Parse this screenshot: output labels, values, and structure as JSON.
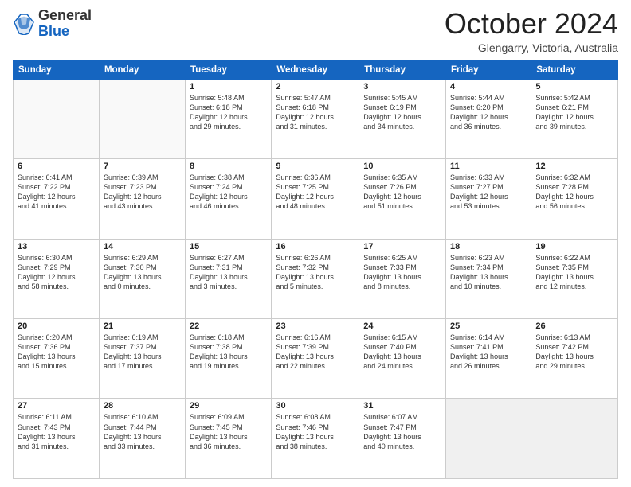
{
  "logo": {
    "general": "General",
    "blue": "Blue"
  },
  "header": {
    "month": "October 2024",
    "location": "Glengarry, Victoria, Australia"
  },
  "days_of_week": [
    "Sunday",
    "Monday",
    "Tuesday",
    "Wednesday",
    "Thursday",
    "Friday",
    "Saturday"
  ],
  "weeks": [
    [
      {
        "day": "",
        "detail": ""
      },
      {
        "day": "",
        "detail": ""
      },
      {
        "day": "1",
        "detail": "Sunrise: 5:48 AM\nSunset: 6:18 PM\nDaylight: 12 hours\nand 29 minutes."
      },
      {
        "day": "2",
        "detail": "Sunrise: 5:47 AM\nSunset: 6:18 PM\nDaylight: 12 hours\nand 31 minutes."
      },
      {
        "day": "3",
        "detail": "Sunrise: 5:45 AM\nSunset: 6:19 PM\nDaylight: 12 hours\nand 34 minutes."
      },
      {
        "day": "4",
        "detail": "Sunrise: 5:44 AM\nSunset: 6:20 PM\nDaylight: 12 hours\nand 36 minutes."
      },
      {
        "day": "5",
        "detail": "Sunrise: 5:42 AM\nSunset: 6:21 PM\nDaylight: 12 hours\nand 39 minutes."
      }
    ],
    [
      {
        "day": "6",
        "detail": "Sunrise: 6:41 AM\nSunset: 7:22 PM\nDaylight: 12 hours\nand 41 minutes."
      },
      {
        "day": "7",
        "detail": "Sunrise: 6:39 AM\nSunset: 7:23 PM\nDaylight: 12 hours\nand 43 minutes."
      },
      {
        "day": "8",
        "detail": "Sunrise: 6:38 AM\nSunset: 7:24 PM\nDaylight: 12 hours\nand 46 minutes."
      },
      {
        "day": "9",
        "detail": "Sunrise: 6:36 AM\nSunset: 7:25 PM\nDaylight: 12 hours\nand 48 minutes."
      },
      {
        "day": "10",
        "detail": "Sunrise: 6:35 AM\nSunset: 7:26 PM\nDaylight: 12 hours\nand 51 minutes."
      },
      {
        "day": "11",
        "detail": "Sunrise: 6:33 AM\nSunset: 7:27 PM\nDaylight: 12 hours\nand 53 minutes."
      },
      {
        "day": "12",
        "detail": "Sunrise: 6:32 AM\nSunset: 7:28 PM\nDaylight: 12 hours\nand 56 minutes."
      }
    ],
    [
      {
        "day": "13",
        "detail": "Sunrise: 6:30 AM\nSunset: 7:29 PM\nDaylight: 12 hours\nand 58 minutes."
      },
      {
        "day": "14",
        "detail": "Sunrise: 6:29 AM\nSunset: 7:30 PM\nDaylight: 13 hours\nand 0 minutes."
      },
      {
        "day": "15",
        "detail": "Sunrise: 6:27 AM\nSunset: 7:31 PM\nDaylight: 13 hours\nand 3 minutes."
      },
      {
        "day": "16",
        "detail": "Sunrise: 6:26 AM\nSunset: 7:32 PM\nDaylight: 13 hours\nand 5 minutes."
      },
      {
        "day": "17",
        "detail": "Sunrise: 6:25 AM\nSunset: 7:33 PM\nDaylight: 13 hours\nand 8 minutes."
      },
      {
        "day": "18",
        "detail": "Sunrise: 6:23 AM\nSunset: 7:34 PM\nDaylight: 13 hours\nand 10 minutes."
      },
      {
        "day": "19",
        "detail": "Sunrise: 6:22 AM\nSunset: 7:35 PM\nDaylight: 13 hours\nand 12 minutes."
      }
    ],
    [
      {
        "day": "20",
        "detail": "Sunrise: 6:20 AM\nSunset: 7:36 PM\nDaylight: 13 hours\nand 15 minutes."
      },
      {
        "day": "21",
        "detail": "Sunrise: 6:19 AM\nSunset: 7:37 PM\nDaylight: 13 hours\nand 17 minutes."
      },
      {
        "day": "22",
        "detail": "Sunrise: 6:18 AM\nSunset: 7:38 PM\nDaylight: 13 hours\nand 19 minutes."
      },
      {
        "day": "23",
        "detail": "Sunrise: 6:16 AM\nSunset: 7:39 PM\nDaylight: 13 hours\nand 22 minutes."
      },
      {
        "day": "24",
        "detail": "Sunrise: 6:15 AM\nSunset: 7:40 PM\nDaylight: 13 hours\nand 24 minutes."
      },
      {
        "day": "25",
        "detail": "Sunrise: 6:14 AM\nSunset: 7:41 PM\nDaylight: 13 hours\nand 26 minutes."
      },
      {
        "day": "26",
        "detail": "Sunrise: 6:13 AM\nSunset: 7:42 PM\nDaylight: 13 hours\nand 29 minutes."
      }
    ],
    [
      {
        "day": "27",
        "detail": "Sunrise: 6:11 AM\nSunset: 7:43 PM\nDaylight: 13 hours\nand 31 minutes."
      },
      {
        "day": "28",
        "detail": "Sunrise: 6:10 AM\nSunset: 7:44 PM\nDaylight: 13 hours\nand 33 minutes."
      },
      {
        "day": "29",
        "detail": "Sunrise: 6:09 AM\nSunset: 7:45 PM\nDaylight: 13 hours\nand 36 minutes."
      },
      {
        "day": "30",
        "detail": "Sunrise: 6:08 AM\nSunset: 7:46 PM\nDaylight: 13 hours\nand 38 minutes."
      },
      {
        "day": "31",
        "detail": "Sunrise: 6:07 AM\nSunset: 7:47 PM\nDaylight: 13 hours\nand 40 minutes."
      },
      {
        "day": "",
        "detail": ""
      },
      {
        "day": "",
        "detail": ""
      }
    ]
  ]
}
